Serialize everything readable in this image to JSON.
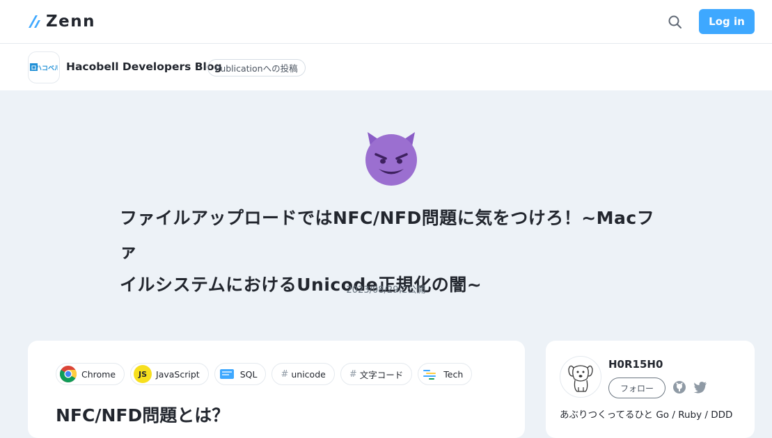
{
  "header": {
    "logo_text": "Zenn",
    "login_label": "Log in"
  },
  "publication": {
    "logo_text": "ハコベル",
    "name": "Hacobell Developers Blog",
    "badge": "Publicationへの投稿"
  },
  "article": {
    "title_line1": "ファイルアップロードではNFC/NFD問題に気をつけろ！~Macファ",
    "title_line2": "イルシステムにおけるUnicode正規化の闇~",
    "published": "2023/08/29に公開",
    "heading": "NFC/NFD問題とは？",
    "topics": [
      {
        "label": "Chrome",
        "icon": "chrome-icon"
      },
      {
        "label": "JavaScript",
        "icon": "javascript-icon"
      },
      {
        "label": "SQL",
        "icon": "sql-icon"
      },
      {
        "label": "unicode",
        "icon": "hash-icon"
      },
      {
        "label": "文字コード",
        "icon": "hash-icon"
      },
      {
        "label": "Tech",
        "icon": "tech-icon"
      }
    ]
  },
  "author": {
    "name": "H0R15H0",
    "follow_label": "フォロー",
    "bio": "あぶりつくってるひと Go / Ruby / DDD"
  },
  "colors": {
    "accent": "#3ea8ff",
    "background": "#edf2f7",
    "emoji": "#9b6fd0"
  }
}
